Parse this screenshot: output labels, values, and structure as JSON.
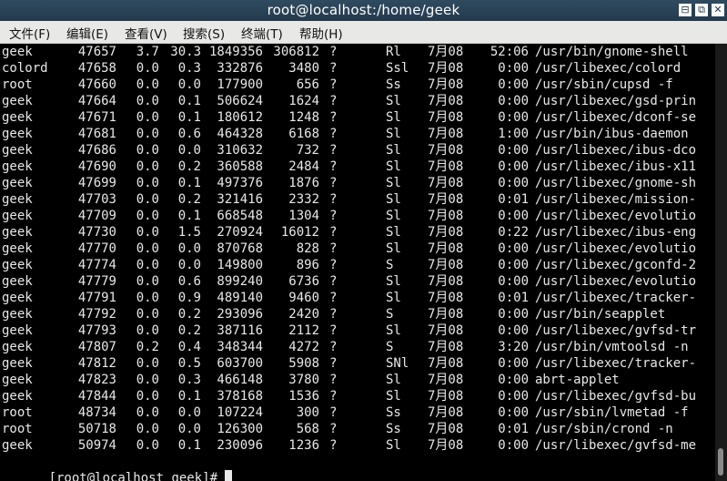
{
  "window": {
    "title": "root@localhost:/home/geek",
    "controls": {
      "minimize": "⊟",
      "maximize": "⧉",
      "close": "✕"
    }
  },
  "menu": [
    "文件(F)",
    "编辑(E)",
    "查看(V)",
    "搜索(S)",
    "终端(T)",
    "帮助(H)"
  ],
  "rows": [
    [
      "geek",
      "47657",
      "3.7",
      "30.3",
      "1849356",
      "306812",
      "?",
      "Rl",
      "7月08",
      "52:06",
      "/usr/bin/gnome-shell"
    ],
    [
      "colord",
      "47658",
      "0.0",
      "0.3",
      "332876",
      "3480",
      "?",
      "Ssl",
      "7月08",
      "0:00",
      "/usr/libexec/colord"
    ],
    [
      "root",
      "47660",
      "0.0",
      "0.0",
      "177900",
      "656",
      "?",
      "Ss",
      "7月08",
      "0:00",
      "/usr/sbin/cupsd -f"
    ],
    [
      "geek",
      "47664",
      "0.0",
      "0.1",
      "506624",
      "1624",
      "?",
      "Sl",
      "7月08",
      "0:00",
      "/usr/libexec/gsd-prin"
    ],
    [
      "geek",
      "47671",
      "0.0",
      "0.1",
      "180612",
      "1248",
      "?",
      "Sl",
      "7月08",
      "0:00",
      "/usr/libexec/dconf-se"
    ],
    [
      "geek",
      "47681",
      "0.0",
      "0.6",
      "464328",
      "6168",
      "?",
      "Sl",
      "7月08",
      "1:00",
      "/usr/bin/ibus-daemon"
    ],
    [
      "geek",
      "47686",
      "0.0",
      "0.0",
      "310632",
      "732",
      "?",
      "Sl",
      "7月08",
      "0:00",
      "/usr/libexec/ibus-dco"
    ],
    [
      "geek",
      "47690",
      "0.0",
      "0.2",
      "360588",
      "2484",
      "?",
      "Sl",
      "7月08",
      "0:00",
      "/usr/libexec/ibus-x11"
    ],
    [
      "geek",
      "47699",
      "0.0",
      "0.1",
      "497376",
      "1876",
      "?",
      "Sl",
      "7月08",
      "0:00",
      "/usr/libexec/gnome-sh"
    ],
    [
      "geek",
      "47703",
      "0.0",
      "0.2",
      "321416",
      "2332",
      "?",
      "Sl",
      "7月08",
      "0:01",
      "/usr/libexec/mission-"
    ],
    [
      "geek",
      "47709",
      "0.0",
      "0.1",
      "668548",
      "1304",
      "?",
      "Sl",
      "7月08",
      "0:00",
      "/usr/libexec/evolutio"
    ],
    [
      "geek",
      "47730",
      "0.0",
      "1.5",
      "270924",
      "16012",
      "?",
      "Sl",
      "7月08",
      "0:22",
      "/usr/libexec/ibus-eng"
    ],
    [
      "geek",
      "47770",
      "0.0",
      "0.0",
      "870768",
      "828",
      "?",
      "Sl",
      "7月08",
      "0:00",
      "/usr/libexec/evolutio"
    ],
    [
      "geek",
      "47774",
      "0.0",
      "0.0",
      "149800",
      "896",
      "?",
      "S",
      "7月08",
      "0:00",
      "/usr/libexec/gconfd-2"
    ],
    [
      "geek",
      "47779",
      "0.0",
      "0.6",
      "899240",
      "6736",
      "?",
      "Sl",
      "7月08",
      "0:00",
      "/usr/libexec/evolutio"
    ],
    [
      "geek",
      "47791",
      "0.0",
      "0.9",
      "489140",
      "9460",
      "?",
      "Sl",
      "7月08",
      "0:01",
      "/usr/libexec/tracker-"
    ],
    [
      "geek",
      "47792",
      "0.0",
      "0.2",
      "293096",
      "2420",
      "?",
      "S",
      "7月08",
      "0:00",
      "/usr/bin/seapplet"
    ],
    [
      "geek",
      "47793",
      "0.0",
      "0.2",
      "387116",
      "2112",
      "?",
      "Sl",
      "7月08",
      "0:00",
      "/usr/libexec/gvfsd-tr"
    ],
    [
      "geek",
      "47807",
      "0.2",
      "0.4",
      "348344",
      "4272",
      "?",
      "S",
      "7月08",
      "3:20",
      "/usr/bin/vmtoolsd -n"
    ],
    [
      "geek",
      "47812",
      "0.0",
      "0.5",
      "603700",
      "5908",
      "?",
      "SNl",
      "7月08",
      "0:00",
      "/usr/libexec/tracker-"
    ],
    [
      "geek",
      "47823",
      "0.0",
      "0.3",
      "466148",
      "3780",
      "?",
      "Sl",
      "7月08",
      "0:00",
      "abrt-applet"
    ],
    [
      "geek",
      "47844",
      "0.0",
      "0.1",
      "378168",
      "1536",
      "?",
      "Sl",
      "7月08",
      "0:00",
      "/usr/libexec/gvfsd-bu"
    ],
    [
      "root",
      "48734",
      "0.0",
      "0.0",
      "107224",
      "300",
      "?",
      "Ss",
      "7月08",
      "0:00",
      "/usr/sbin/lvmetad -f"
    ],
    [
      "root",
      "50718",
      "0.0",
      "0.0",
      "126300",
      "568",
      "?",
      "Ss",
      "7月08",
      "0:01",
      "/usr/sbin/crond -n"
    ],
    [
      "geek",
      "50974",
      "0.0",
      "0.1",
      "230096",
      "1236",
      "?",
      "Sl",
      "7月08",
      "0:00",
      "/usr/libexec/gvfsd-me"
    ]
  ],
  "prompt": "[root@localhost geek]#"
}
